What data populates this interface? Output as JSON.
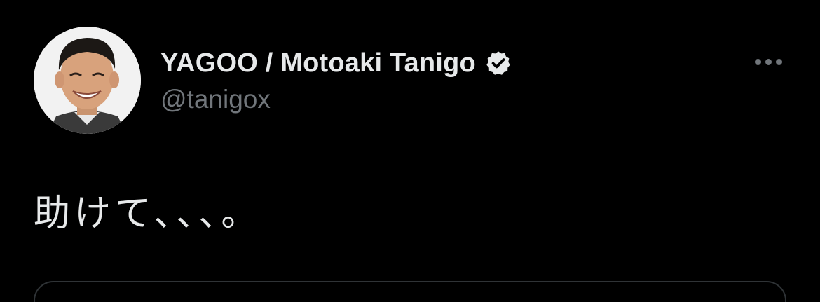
{
  "tweet": {
    "author": {
      "display_name": "YAGOO / Motoaki Tanigo",
      "handle": "@tanigox",
      "verified": true,
      "verified_badge_color": "#e7e9ea"
    },
    "text": "助けて、、、。",
    "more_icon": "more-horizontal-icon"
  },
  "colors": {
    "background": "#000000",
    "primary_text": "#e7e9ea",
    "secondary_text": "#71767b",
    "border": "#2f3336"
  }
}
